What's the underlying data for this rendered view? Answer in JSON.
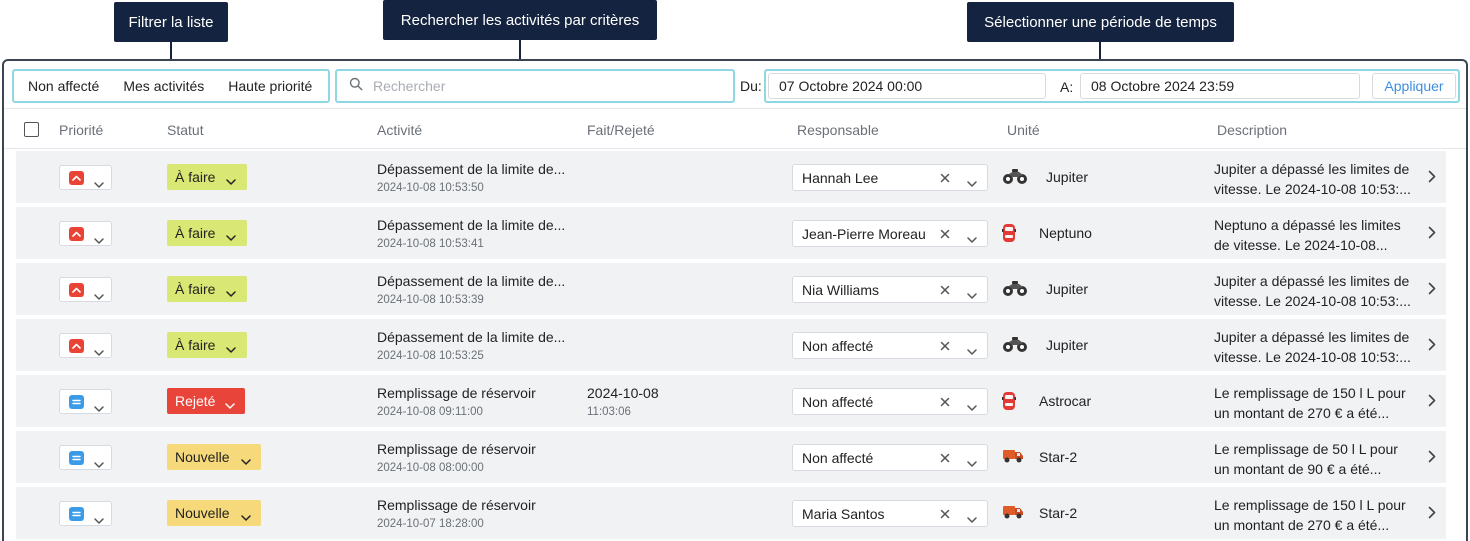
{
  "callouts": {
    "filter": "Filtrer la liste",
    "search": "Rechercher les activités par critères",
    "period": "Sélectionner une période de temps"
  },
  "filters": {
    "unassigned": "Non affecté",
    "mine": "Mes activités",
    "high_priority": "Haute priorité"
  },
  "search": {
    "placeholder": "Rechercher"
  },
  "period": {
    "from_label": "Du:",
    "from_value": "07 Octobre 2024 00:00",
    "to_label": "A:",
    "to_value": "08 Octobre 2024 23:59",
    "apply_label": "Appliquer"
  },
  "columns": {
    "priority": "Priorité",
    "status": "Statut",
    "activity": "Activité",
    "done": "Fait/Rejeté",
    "owner": "Responsable",
    "unit": "Unité",
    "description": "Description"
  },
  "colors": {
    "accent": "#3d8fe0",
    "filter_border": "#8fd7e3",
    "status_todo": "#d9e774",
    "status_rejected": "#e9443a",
    "status_new": "#f6d97a",
    "priority_high": "#ea4335",
    "priority_medium": "#3a9be8"
  },
  "rows": [
    {
      "priority": "high",
      "priority_icon": "chevron-up-icon",
      "status": "À faire",
      "activity": "Dépassement de la limite de...",
      "activity_time": "2024-10-08 10:53:50",
      "done_date": "",
      "done_time": "",
      "owner": "Hannah Lee",
      "unit_icon": "motorcycle-icon",
      "unit": "Jupiter",
      "desc_line1": "Jupiter a dépassé les limites de",
      "desc_line2": "vitesse. Le 2024-10-08 10:53:..."
    },
    {
      "priority": "high",
      "priority_icon": "chevron-up-icon",
      "status": "À faire",
      "activity": "Dépassement de la limite de...",
      "activity_time": "2024-10-08 10:53:41",
      "done_date": "",
      "done_time": "",
      "owner": "Jean-Pierre Moreau",
      "unit_icon": "car-icon",
      "unit": "Neptuno",
      "desc_line1": "Neptuno a dépassé les limites",
      "desc_line2": "de vitesse. Le 2024-10-08..."
    },
    {
      "priority": "high",
      "priority_icon": "chevron-up-icon",
      "status": "À faire",
      "activity": "Dépassement de la limite de...",
      "activity_time": "2024-10-08 10:53:39",
      "done_date": "",
      "done_time": "",
      "owner": "Nia Williams",
      "unit_icon": "motorcycle-icon",
      "unit": "Jupiter",
      "desc_line1": "Jupiter a dépassé les limites de",
      "desc_line2": "vitesse. Le 2024-10-08 10:53:..."
    },
    {
      "priority": "high",
      "priority_icon": "chevron-up-icon",
      "status": "À faire",
      "activity": "Dépassement de la limite de...",
      "activity_time": "2024-10-08 10:53:25",
      "done_date": "",
      "done_time": "",
      "owner": "Non affecté",
      "unit_icon": "motorcycle-icon",
      "unit": "Jupiter",
      "desc_line1": "Jupiter a dépassé les limites de",
      "desc_line2": "vitesse. Le 2024-10-08 10:53:..."
    },
    {
      "priority": "medium",
      "priority_icon": "equals-icon",
      "status": "Rejeté",
      "activity": "Remplissage de réservoir",
      "activity_time": "2024-10-08 09:11:00",
      "done_date": "2024-10-08",
      "done_time": "11:03:06",
      "owner": "Non affecté",
      "unit_icon": "car-icon",
      "unit": "Astrocar",
      "desc_line1": "Le remplissage de 150 l L pour",
      "desc_line2": "un montant de 270 € a été..."
    },
    {
      "priority": "medium",
      "priority_icon": "equals-icon",
      "status": "Nouvelle",
      "activity": "Remplissage de réservoir",
      "activity_time": "2024-10-08 08:00:00",
      "done_date": "",
      "done_time": "",
      "owner": "Non affecté",
      "unit_icon": "truck-icon",
      "unit": "Star-2",
      "desc_line1": "Le remplissage de 50 l L pour",
      "desc_line2": "un montant de 90 € a été..."
    },
    {
      "priority": "medium",
      "priority_icon": "equals-icon",
      "status": "Nouvelle",
      "activity": "Remplissage de réservoir",
      "activity_time": "2024-10-07 18:28:00",
      "done_date": "",
      "done_time": "",
      "owner": "Maria Santos",
      "unit_icon": "truck-icon",
      "unit": "Star-2",
      "desc_line1": "Le remplissage de 150 l L pour",
      "desc_line2": "un montant de 270 € a été..."
    }
  ]
}
